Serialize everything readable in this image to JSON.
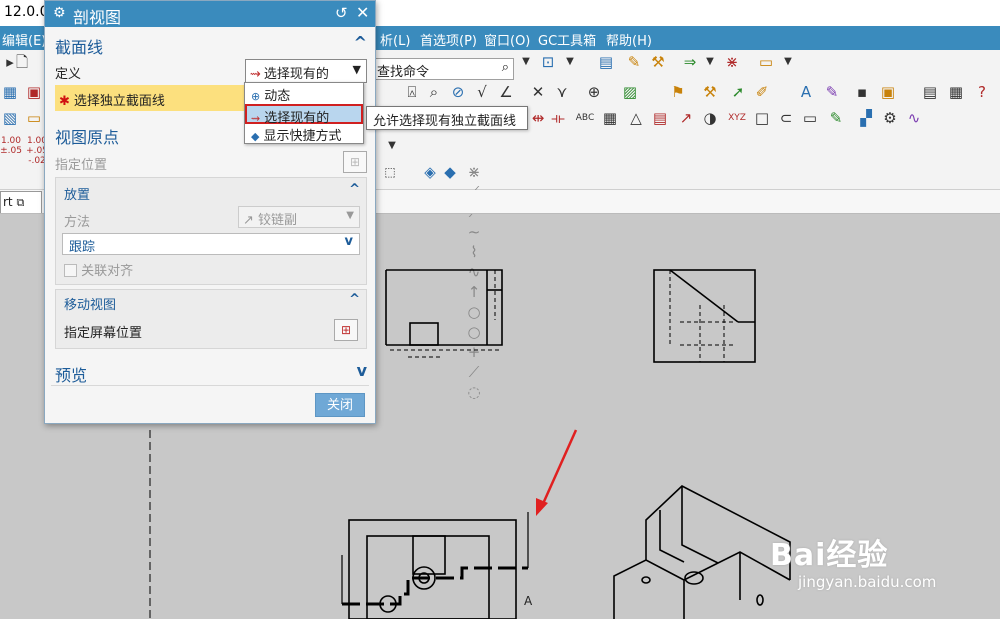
{
  "app": {
    "version": "12.0.0"
  },
  "menubar": {
    "items": [
      "编辑(E)",
      "析(L)",
      "首选项(P)",
      "窗口(O)",
      "GC工具箱",
      "帮助(H)"
    ]
  },
  "toolbar": {
    "search_placeholder": "查找命令",
    "row2_labels": [
      "1.00\n±.05",
      "1.00\n+.05\n-.02"
    ],
    "abc_label": "ABC",
    "xyz_label": "XYZ"
  },
  "tabs": {
    "part_tab": "rt"
  },
  "dialog": {
    "title": "剖视图",
    "section_line": {
      "header": "截面线",
      "definition_label": "定义",
      "definition_value": "选择现有的",
      "required_step": "选择独立截面线"
    },
    "view_origin": {
      "header": "视图原点",
      "specify_location": "指定位置",
      "placement": {
        "header": "放置",
        "method_label": "方法",
        "method_value": "铰链副",
        "tracking_value": "跟踪",
        "associative_align": "关联对齐"
      },
      "move_view": {
        "header": "移动视图",
        "specify_screen_location": "指定屏幕位置"
      }
    },
    "preview": {
      "header": "预览"
    },
    "close_label": "关闭"
  },
  "dropdown": {
    "options": [
      "动态",
      "选择现有的",
      "显示快捷方式"
    ],
    "selected_index": 1
  },
  "tooltip": {
    "text": "允许选择现有独立截面线"
  },
  "drawing": {
    "section_label": "A"
  },
  "watermark": {
    "brand": "Bai经验",
    "url": "jingyan.baidu.com"
  }
}
